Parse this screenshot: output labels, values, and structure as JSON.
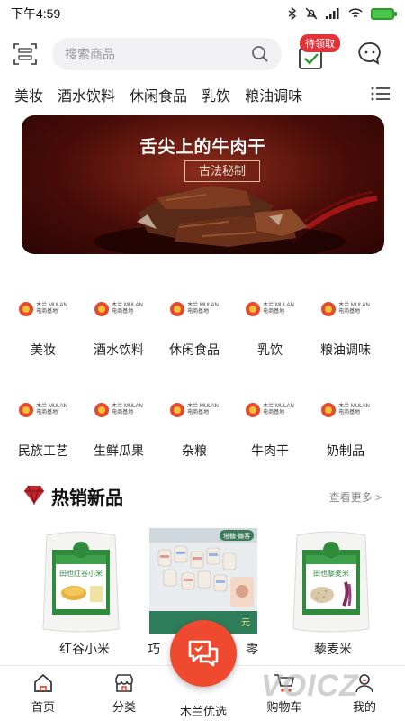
{
  "status_bar": {
    "time": "下午4:59"
  },
  "header": {
    "search_placeholder": "搜索商品",
    "badge": "待领取"
  },
  "tabs": [
    "美妆",
    "酒水饮料",
    "休闲食品",
    "乳饮",
    "粮油调味"
  ],
  "banner": {
    "title": "舌尖上的牛肉干",
    "subtitle": "古法秘制"
  },
  "brand_logo": {
    "name_cn": "木兰",
    "name_en": "MULAN",
    "sub": "电商基地"
  },
  "categories": [
    [
      "美妆",
      "酒水饮料",
      "休闲食品",
      "乳饮",
      "粮油调味"
    ],
    [
      "民族工艺",
      "生鲜瓜果",
      "杂粮",
      "牛肉干",
      "奶制品"
    ]
  ],
  "hot_section": {
    "title": "热销新品",
    "more": "查看更多 >"
  },
  "products": [
    {
      "label": "红谷小米",
      "bag_brand": "田也红谷小米"
    },
    {
      "label": "巧",
      "tag": "塔糖·糖客",
      "tail": "零",
      "price_hint": "元"
    },
    {
      "label": "藜麦米",
      "bag_brand": "田也藜麦米"
    }
  ],
  "bottom_nav": [
    "首页",
    "分类",
    "木兰优选",
    "购物车",
    "我的"
  ],
  "watermark": "VOICZ",
  "colors": {
    "accent": "#ef4a2f",
    "badge": "#e2333a",
    "banner_bg": "#4a0d08",
    "check": "#2e9a2e"
  }
}
